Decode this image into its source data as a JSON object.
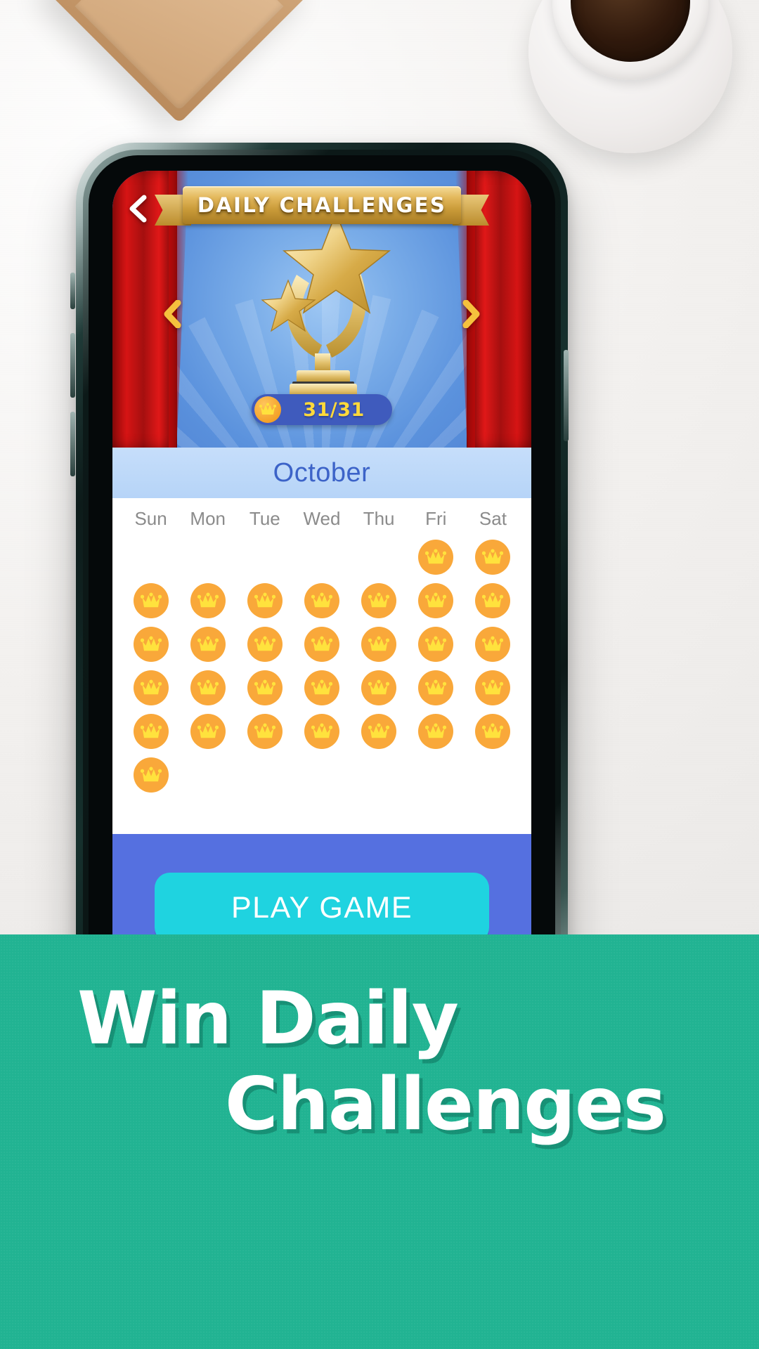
{
  "background": {
    "desk_color": "#f2f0ee",
    "envelope_color": "#c79a6c",
    "coffee_color": "#30190c"
  },
  "phone": {
    "frame_color": "#0d1b1a",
    "screen_bg": "#5570e0"
  },
  "game": {
    "header": {
      "back_icon": "chevron-left-icon",
      "banner_title": "DAILY CHALLENGES",
      "banner_color": "#c99a38"
    },
    "stage": {
      "curtain_color": "#d61414",
      "backdrop_color": "#5b92dd",
      "trophy_icon": "star-trophy-icon",
      "prev_icon": "chevron-left-icon",
      "next_icon": "chevron-right-icon",
      "arrow_color": "#f5c13d"
    },
    "progress": {
      "crown_icon": "crown-coin-icon",
      "value": "31/31",
      "pill_color": "#3f5bbd",
      "text_color": "#ffd93b"
    },
    "calendar": {
      "month": "October",
      "month_bar_color": "#b6d4f8",
      "month_text_color": "#3c63c8",
      "weekdays": [
        "Sun",
        "Mon",
        "Tue",
        "Wed",
        "Thu",
        "Fri",
        "Sat"
      ],
      "crown_icon": "crown-icon",
      "crown_circle_color": "#f9a83a",
      "crown_glyph_color": "#ffe23d",
      "leading_blanks": 5,
      "days_completed": 31,
      "total_cells": 36
    },
    "play_button": {
      "label": "PLAY  GAME",
      "color": "#1fd3e0",
      "text_color": "#ffffff"
    }
  },
  "promo": {
    "background_color": "#21b392",
    "line1": "Win Daily",
    "line2": "Challenges",
    "text_color": "#ffffff"
  }
}
